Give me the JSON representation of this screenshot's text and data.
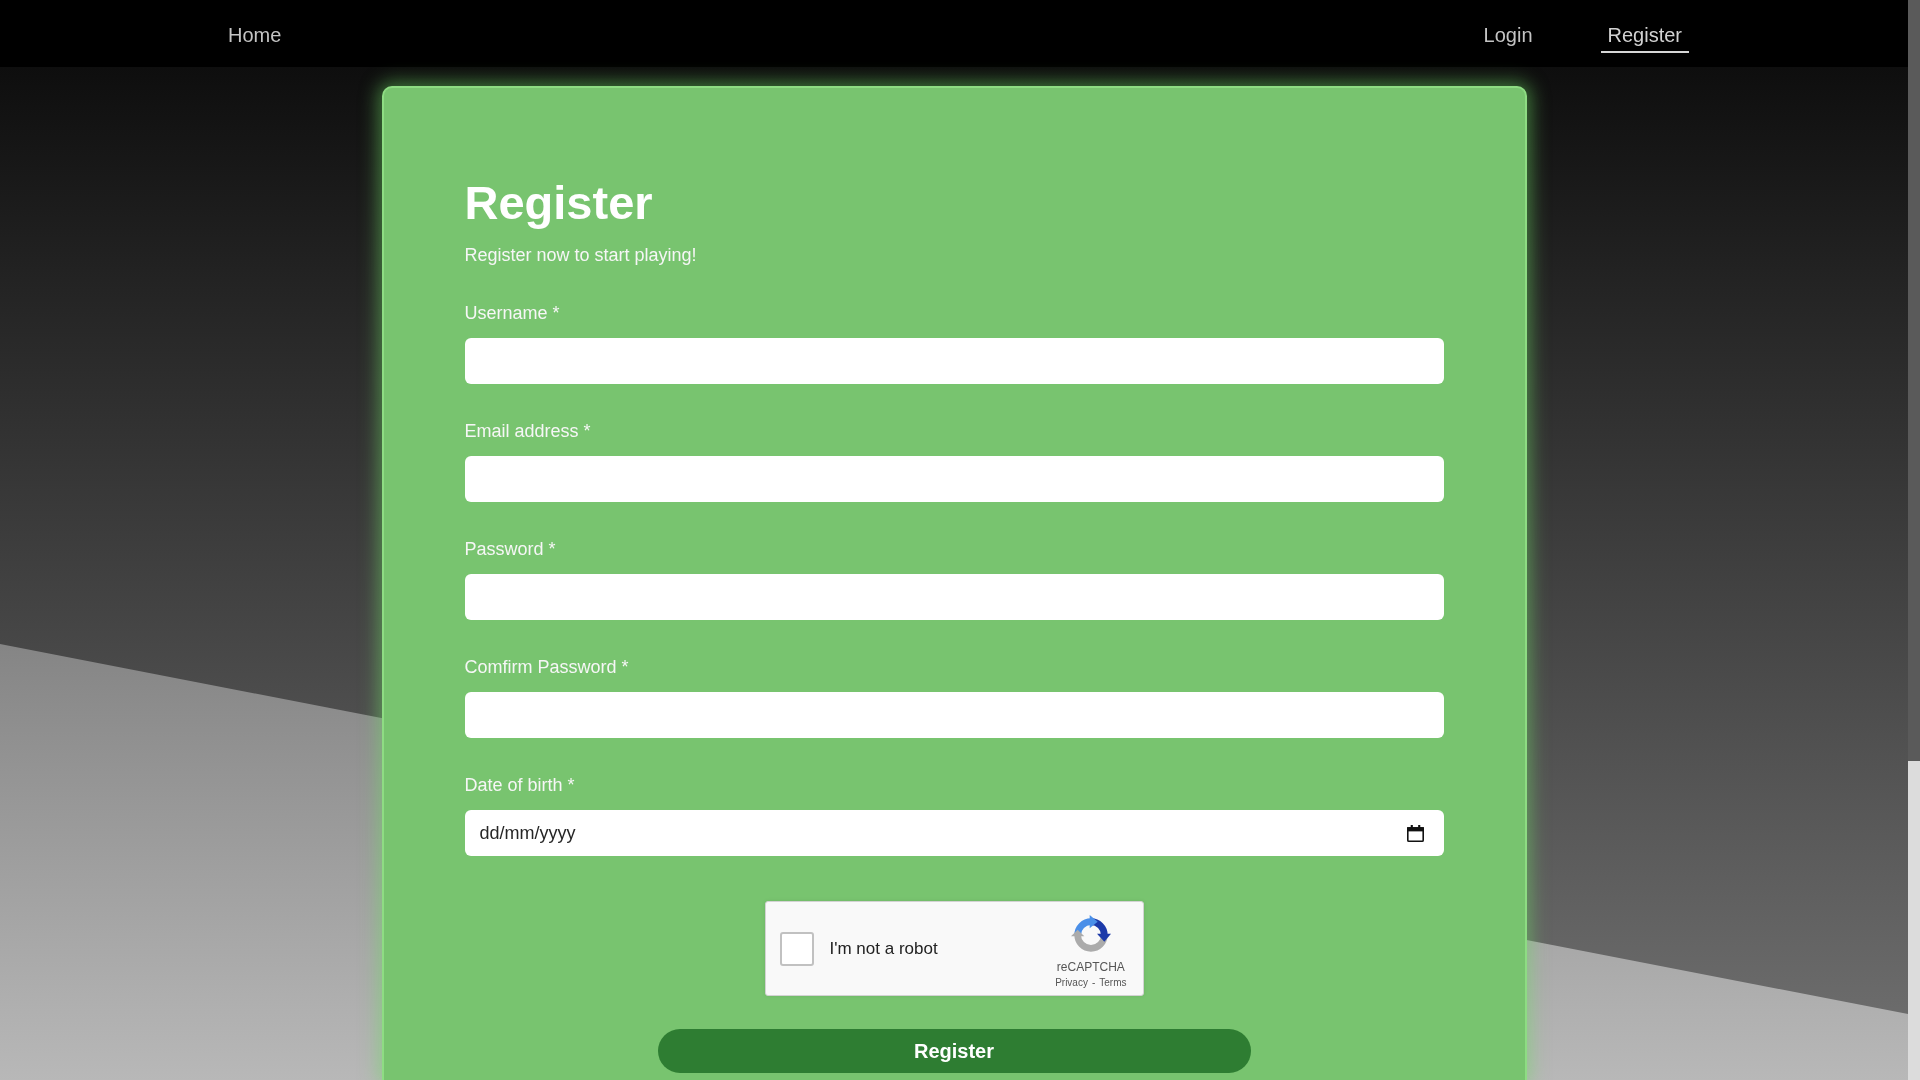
{
  "nav": {
    "left_links": [
      {
        "label": "Home",
        "selected": false
      }
    ],
    "right_links": [
      {
        "label": "Login",
        "selected": false
      },
      {
        "label": "Register",
        "selected": true
      }
    ]
  },
  "form": {
    "title": "Register",
    "subtitle": "Register now to start playing!",
    "fields": [
      {
        "kind": "text",
        "label": "Username *"
      },
      {
        "kind": "text",
        "label": "Email address *"
      },
      {
        "kind": "text",
        "label": "Password *"
      },
      {
        "kind": "text",
        "label": "Comfirm Password *"
      },
      {
        "kind": "date",
        "label": "Date of birth *",
        "placeholder": "dd/mm/yyyy"
      }
    ],
    "captcha": {
      "checked": false,
      "label": "I'm not a robot",
      "brand": "reCAPTCHA",
      "links": [
        "Privacy",
        "Terms"
      ],
      "link_separator": "-"
    },
    "submit_button": "Register"
  }
}
